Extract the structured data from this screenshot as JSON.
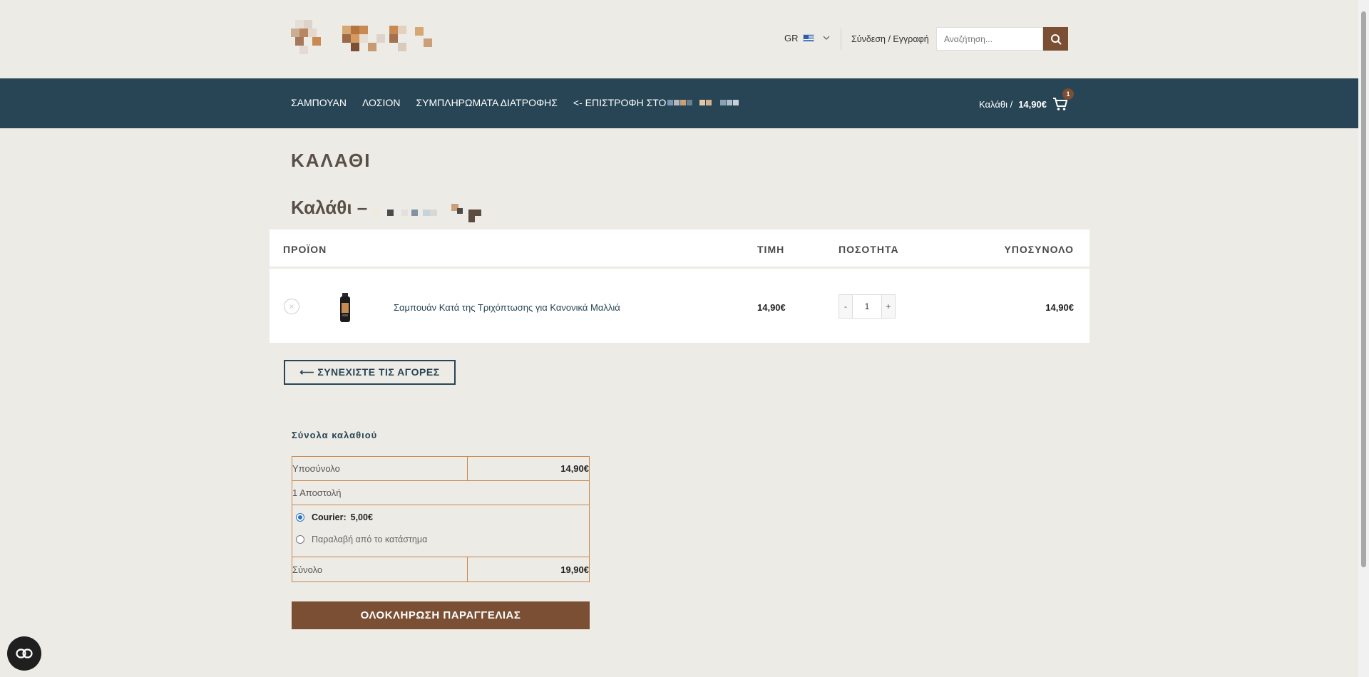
{
  "header": {
    "language": "GR",
    "login_label": "Σύνδεση / Εγγραφή",
    "search_placeholder": "Αναζήτηση...",
    "icons": {
      "search": "search-icon",
      "chevron": "chevron-down-icon",
      "flag": "greek-flag-icon"
    }
  },
  "nav": {
    "items": [
      {
        "label": "ΣΑΜΠΟΥΑΝ"
      },
      {
        "label": "ΛΟΣΙΟΝ"
      },
      {
        "label": "ΣΥΜΠΛΗΡΩΜΑΤΑ ΔΙΑΤΡΟΦΗΣ"
      },
      {
        "label": "<- ΕΠΙΣΤΡΟΦΗ ΣΤΟ"
      }
    ],
    "cart_label": "Καλάθι /",
    "cart_amount": "14,90€",
    "cart_count": "1"
  },
  "page": {
    "title": "ΚΑΛΑΘΙ",
    "cart_heading": "Καλάθι –"
  },
  "cart": {
    "headers": {
      "product": "ΠΡΟΪΟΝ",
      "price": "ΤΙΜΗ",
      "quantity": "ΠΟΣΟΤΗΤΑ",
      "subtotal": "ΥΠΟΣΥΝΟΛΟ"
    },
    "items": [
      {
        "name": "Σαμπουάν Κατά της Τριχόπτωσης για Κανονικά Μαλλιά",
        "price": "14,90€",
        "quantity": "1",
        "subtotal": "14,90€"
      }
    ],
    "qty_minus": "-",
    "qty_plus": "+",
    "remove": "×",
    "continue_label": "⟵ ΣΥΝΕΧΙΣΤΕ ΤΙΣ ΑΓΟΡΕΣ"
  },
  "totals": {
    "title": "Σύνολα καλαθιού",
    "subtotal_label": "Υποσύνολο",
    "subtotal_value": "14,90€",
    "shipping_label": "1 Αποστολή",
    "options": [
      {
        "name": "Courier:",
        "price": "5,00€",
        "selected": true
      },
      {
        "name": "Παραλαβή από το κατάστημα",
        "selected": false
      }
    ],
    "total_label": "Σύνολο",
    "total_value": "19,90€",
    "checkout_label": "ΟΛΟΚΛΗΡΩΣΗ ΠΑΡΑΓΓΕΛΙΑΣ"
  },
  "colors": {
    "background": "#edebe6",
    "nav": "#284555",
    "accent": "#7a4f33",
    "border": "#c8864d"
  }
}
